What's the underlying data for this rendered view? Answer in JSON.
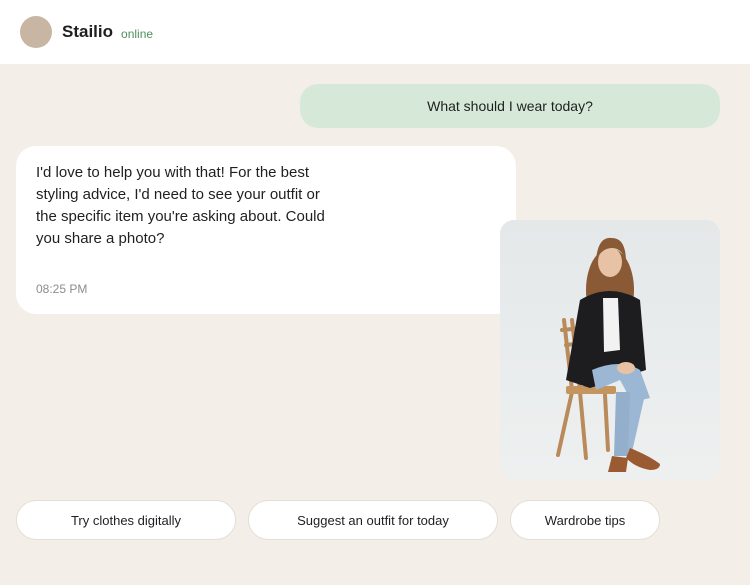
{
  "header": {
    "name": "Stailio",
    "status": "online"
  },
  "messages": {
    "user": "What should I wear today?",
    "bot": "I'd love to help you with that! For the best styling advice, I'd need to see your outfit or the specific item you're asking about. Could you share a photo?",
    "bot_time": "08:25 PM"
  },
  "photo": {
    "icon": "person-photo"
  },
  "suggestions": [
    {
      "label": "Try clothes digitally"
    },
    {
      "label": "Suggest an outfit for today"
    },
    {
      "label": "Wardrobe tips"
    }
  ],
  "colors": {
    "background": "#f3efe8",
    "user_bubble": "#d6e9d8",
    "status_green": "#4f8f5f",
    "avatar": "#c9b5a3"
  }
}
